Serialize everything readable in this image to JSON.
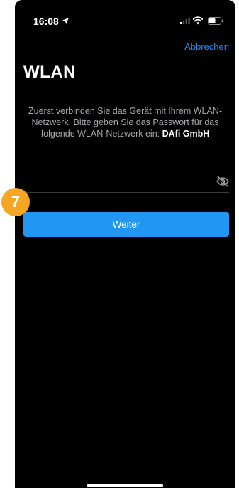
{
  "statusbar": {
    "time": "16:08",
    "icons": [
      "location-arrow-icon",
      "signal-icon",
      "wifi-icon",
      "battery-icon"
    ]
  },
  "header": {
    "cancel_label": "Abbrechen",
    "title": "WLAN"
  },
  "instructions": {
    "text": "Zuerst verbinden Sie das Gerät mit Ihrem WLAN-Netzwerk. Bitte geben Sie das Passwort für das folgende WLAN-Netzwerk ein:",
    "network_name": "DAfi GmbH"
  },
  "password_field": {
    "value": "",
    "placeholder": "",
    "toggle_icon": "eye-slash-icon"
  },
  "step_badge": {
    "number": "7",
    "color": "#f5a623"
  },
  "actions": {
    "continue_label": "Weiter"
  },
  "colors": {
    "background": "#000000",
    "accent": "#2196f3",
    "link": "#2d8cf0",
    "badge": "#f5a623"
  }
}
